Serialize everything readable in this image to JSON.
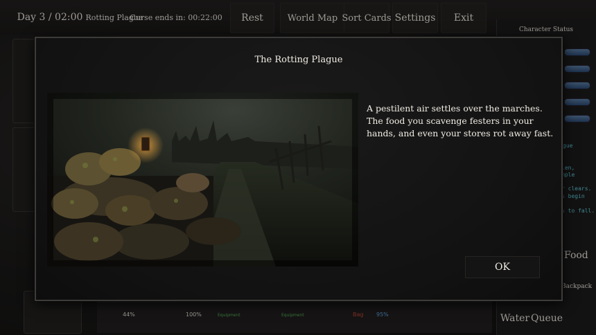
{
  "topbar": {
    "day_time": "Day 3 / 02:00",
    "event_name": "Rotting Plague",
    "curse_timer": "Curse ends in: 00:22:00",
    "rest_label": "Rest",
    "world_map_label": "World Map",
    "sort_cards_label": "Sort Cards",
    "settings_label": "Settings",
    "exit_label": "Exit"
  },
  "side_panel": {
    "title": "Character Status",
    "partial_text": [
      "gue",
      "len,",
      "mple",
      "r clears.",
      "s begin",
      "s to fall."
    ],
    "food_label": "Food",
    "backpack_label": "Backpack",
    "water_label": "Water",
    "queue_label": "Queue"
  },
  "bottom_bar": {
    "values": [
      "44%",
      "100%",
      "Equipment",
      "Equipment",
      "Bag",
      "95%"
    ]
  },
  "modal": {
    "title": "The Rotting Plague",
    "body": "A pestilent air settles over the marches. The food you scavenge festers in your hands, and even your stores rot away fast.",
    "ok_label": "OK"
  },
  "colors": {
    "accent_cyan": "#5fd0e0",
    "status_bar_blue": "#4a6f9a",
    "equipment_green": "#57b05a",
    "bag_red": "#c44a3a",
    "percent_blue": "#5fa8e6"
  }
}
